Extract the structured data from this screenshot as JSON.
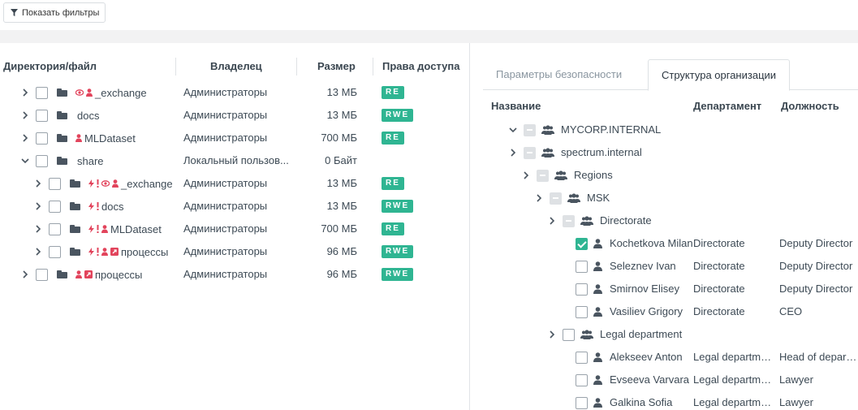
{
  "toolbar": {
    "filter_label": "Показать фильтры"
  },
  "files": {
    "columns": [
      "Директория/файл",
      "Владелец",
      "Размер",
      "Права доступа"
    ],
    "rows": [
      {
        "name": "_exchange",
        "depth": 0,
        "expanded": false,
        "badges": [
          "eye",
          "user"
        ],
        "owner": "Администраторы",
        "size": "13 МБ",
        "rights": "RE"
      },
      {
        "name": "docs",
        "depth": 0,
        "expanded": false,
        "badges": [],
        "owner": "Администраторы",
        "size": "13 МБ",
        "rights": "RWE"
      },
      {
        "name": "MLDataset",
        "depth": 0,
        "expanded": false,
        "badges": [
          "user"
        ],
        "owner": "Администраторы",
        "size": "700 МБ",
        "rights": "RE"
      },
      {
        "name": "share",
        "depth": 0,
        "expanded": true,
        "badges": [],
        "owner": "Локальный пользов...",
        "size": "0 Байт",
        "rights": ""
      },
      {
        "name": "_exchange",
        "depth": 1,
        "expanded": false,
        "badges": [
          "bolt",
          "warn",
          "eye",
          "user"
        ],
        "owner": "Администраторы",
        "size": "13 МБ",
        "rights": "RE"
      },
      {
        "name": "docs",
        "depth": 1,
        "expanded": false,
        "badges": [
          "bolt",
          "warn"
        ],
        "owner": "Администраторы",
        "size": "13 МБ",
        "rights": "RWE"
      },
      {
        "name": "MLDataset",
        "depth": 1,
        "expanded": false,
        "badges": [
          "bolt",
          "warn",
          "user"
        ],
        "owner": "Администраторы",
        "size": "700 МБ",
        "rights": "RE"
      },
      {
        "name": "процессы",
        "depth": 1,
        "expanded": false,
        "badges": [
          "bolt",
          "warn",
          "user",
          "link"
        ],
        "owner": "Администраторы",
        "size": "96 МБ",
        "rights": "RWE"
      },
      {
        "name": "процессы",
        "depth": 0,
        "expanded": false,
        "badges": [
          "user",
          "link"
        ],
        "owner": "Администраторы",
        "size": "96 МБ",
        "rights": "RWE"
      }
    ]
  },
  "tabs": [
    {
      "label": "Параметры безопасности",
      "active": false
    },
    {
      "label": "Структура организации",
      "active": true
    }
  ],
  "org": {
    "columns": [
      "Название",
      "Департамент",
      "Должность"
    ],
    "rows": [
      {
        "name": "MYCORP.INTERNAL",
        "depth": 0,
        "type": "group",
        "chevron": "down",
        "check": "ind",
        "dept": "",
        "pos": ""
      },
      {
        "name": "spectrum.internal",
        "depth": 0,
        "type": "group",
        "chevron": "right",
        "check": "ind",
        "dept": "",
        "pos": ""
      },
      {
        "name": "Regions",
        "depth": 1,
        "type": "group",
        "chevron": "right",
        "check": "ind",
        "dept": "",
        "pos": ""
      },
      {
        "name": "MSK",
        "depth": 2,
        "type": "group",
        "chevron": "right",
        "check": "ind",
        "dept": "",
        "pos": ""
      },
      {
        "name": "Directorate",
        "depth": 3,
        "type": "group",
        "chevron": "right",
        "check": "ind",
        "dept": "",
        "pos": ""
      },
      {
        "name": "Kochetkova Milana",
        "depth": 4,
        "type": "user",
        "chevron": "",
        "check": "on",
        "dept": "Directorate",
        "pos": "Deputy Director"
      },
      {
        "name": "Seleznev Ivan",
        "depth": 4,
        "type": "user",
        "chevron": "",
        "check": "off",
        "dept": "Directorate",
        "pos": "Deputy Director"
      },
      {
        "name": "Smirnov Elisey",
        "depth": 4,
        "type": "user",
        "chevron": "",
        "check": "off",
        "dept": "Directorate",
        "pos": "Deputy Director"
      },
      {
        "name": "Vasiliev Grigory",
        "depth": 4,
        "type": "user",
        "chevron": "",
        "check": "off",
        "dept": "Directorate",
        "pos": "CEO"
      },
      {
        "name": "Legal department",
        "depth": 3,
        "type": "group",
        "chevron": "right",
        "check": "off",
        "dept": "",
        "pos": ""
      },
      {
        "name": "Alekseev Anton",
        "depth": 4,
        "type": "user",
        "chevron": "",
        "check": "off",
        "dept": "Legal department",
        "pos": "Head of department"
      },
      {
        "name": "Evseeva Varvara",
        "depth": 4,
        "type": "user",
        "chevron": "",
        "check": "off",
        "dept": "Legal department",
        "pos": "Lawyer"
      },
      {
        "name": "Galkina Sofia",
        "depth": 4,
        "type": "user",
        "chevron": "",
        "check": "off",
        "dept": "Legal department",
        "pos": "Lawyer"
      }
    ]
  },
  "colors": {
    "accent": "#2fb592",
    "badge_red": "#e2445c",
    "text": "#3d4a55"
  }
}
